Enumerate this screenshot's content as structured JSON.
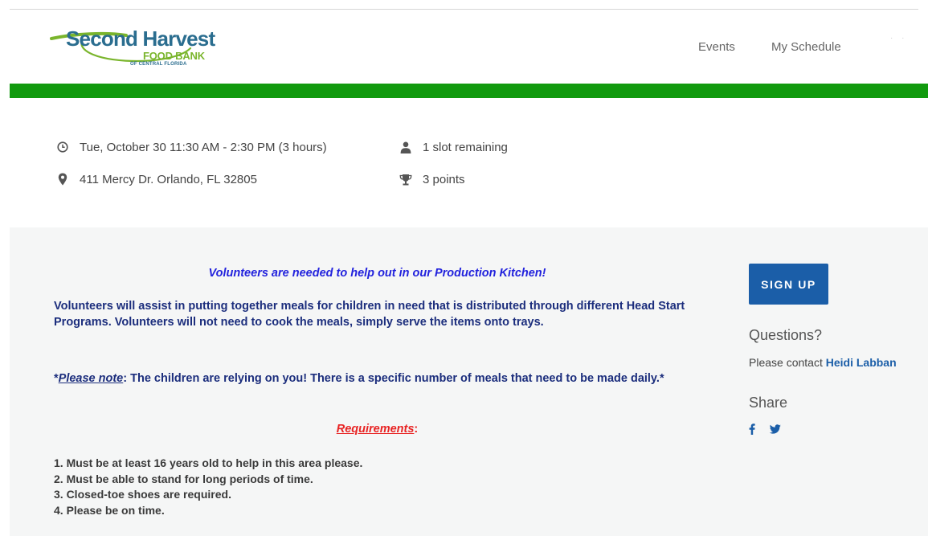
{
  "brand": {
    "line1": "Second Harvest",
    "line2": "FOOD BANK",
    "line3": "OF CENTRAL FLORIDA",
    "primary_color": "#2a6d8f",
    "accent_color": "#7ab52c"
  },
  "nav": {
    "events": "Events",
    "my_schedule": "My Schedule"
  },
  "event_info": {
    "datetime": "Tue, October 30 11:30 AM - 2:30 PM (3 hours)",
    "address": "411 Mercy Dr. Orlando, FL 32805",
    "slots": "1 slot remaining",
    "points": "3 points",
    "icons": [
      "clock-icon",
      "map-pin-icon",
      "user-icon",
      "trophy-icon"
    ]
  },
  "description": {
    "headline": "Volunteers are needed to help out in our Production Kitchen!",
    "paragraph1": "Volunteers will assist in putting together meals for children in need that is distributed through different Head Start Programs. Volunteers will not need to cook the meals, simply serve the items onto trays.",
    "note_prefix": "*",
    "note_label": "Please note",
    "note_text": ": The children are relying on you! There is a specific number of meals that need to be made daily.*",
    "requirements_label": "Requirements",
    "requirements_colon": ":",
    "requirements": [
      "1. Must be at least 16 years old to help in this area please.",
      "2. Must be able to stand for long periods of time.",
      "3. Closed-toe shoes are required.",
      "4. Please be on time."
    ]
  },
  "sidebar": {
    "signup_label": "SIGN UP",
    "questions_title": "Questions?",
    "contact_prefix": "Please contact ",
    "contact_name": "Heidi Labban",
    "share_title": "Share",
    "share_icons": [
      "facebook-icon",
      "twitter-icon"
    ]
  },
  "colors": {
    "green_bar": "#119a0e",
    "signup_button": "#1b5ea8",
    "headline_text": "#2222dd",
    "body_text": "#1c2e7d",
    "requirements_heading": "#e82424",
    "panel_background": "#f5f6f6"
  }
}
